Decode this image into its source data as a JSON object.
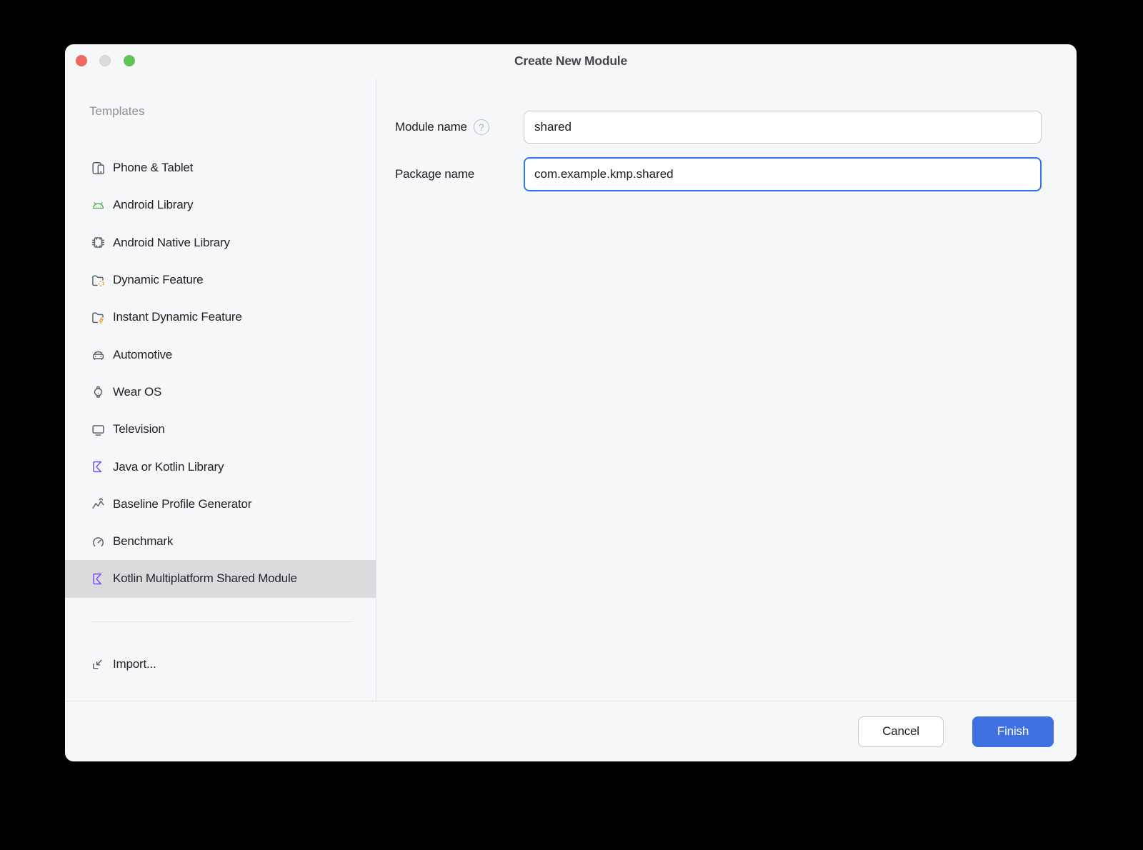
{
  "window": {
    "title": "Create New Module",
    "controls": [
      {
        "name": "close",
        "color": "#ee6a5e"
      },
      {
        "name": "minimize",
        "color": "#dcdcdc"
      },
      {
        "name": "zoom",
        "color": "#62c454"
      }
    ]
  },
  "sidebar": {
    "header": "Templates",
    "items": [
      {
        "id": "phone-tablet",
        "label": "Phone & Tablet",
        "icon": "phone-tablet-icon",
        "selected": false
      },
      {
        "id": "android-library",
        "label": "Android Library",
        "icon": "android-head-icon",
        "selected": false
      },
      {
        "id": "android-native-library",
        "label": "Android Native Library",
        "icon": "chip-icon",
        "selected": false
      },
      {
        "id": "dynamic-feature",
        "label": "Dynamic Feature",
        "icon": "folder-dynamic-icon",
        "selected": false
      },
      {
        "id": "instant-dynamic-feature",
        "label": "Instant Dynamic Feature",
        "icon": "folder-instant-icon",
        "selected": false
      },
      {
        "id": "automotive",
        "label": "Automotive",
        "icon": "car-icon",
        "selected": false
      },
      {
        "id": "wear-os",
        "label": "Wear OS",
        "icon": "watch-icon",
        "selected": false
      },
      {
        "id": "television",
        "label": "Television",
        "icon": "tv-icon",
        "selected": false
      },
      {
        "id": "java-kotlin-library",
        "label": "Java or Kotlin Library",
        "icon": "kotlin-icon",
        "selected": false
      },
      {
        "id": "baseline-profile-generator",
        "label": "Baseline Profile Generator",
        "icon": "profile-chart-icon",
        "selected": false
      },
      {
        "id": "benchmark",
        "label": "Benchmark",
        "icon": "gauge-icon",
        "selected": false
      },
      {
        "id": "kotlin-multiplatform-shared-module",
        "label": "Kotlin Multiplatform Shared Module",
        "icon": "kotlin-icon",
        "selected": true
      }
    ],
    "import_item": {
      "label": "Import...",
      "icon": "import-arrow-icon"
    }
  },
  "form": {
    "module_name": {
      "label": "Module name",
      "value": "shared",
      "help_icon_glyph": "?",
      "focused": false
    },
    "package_name": {
      "label": "Package name",
      "value": "com.example.kmp.shared",
      "focused": true
    }
  },
  "footer": {
    "cancel_label": "Cancel",
    "finish_label": "Finish"
  },
  "colors": {
    "accent_blue": "#3e70e2",
    "focus_border": "#3574f0",
    "kotlin_purple": "#7c55f5",
    "android_green": "#58b663",
    "warning_orange": "#e8a33d",
    "selected_row": "#dbdbde",
    "window_bg": "#f6f7f8"
  }
}
